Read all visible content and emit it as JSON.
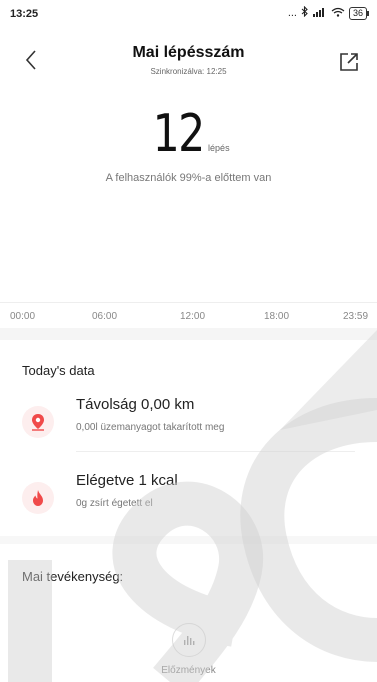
{
  "status_bar": {
    "time": "13:25",
    "dots": "...",
    "battery": "36"
  },
  "header": {
    "title": "Mai lépésszám",
    "subtitle": "Szinkronizálva: 12:25"
  },
  "steps": {
    "value": "12",
    "unit": "lépés",
    "rank_text": "A felhasználók 99%-a előttem van"
  },
  "timeline": {
    "ticks": [
      "00:00",
      "06:00",
      "12:00",
      "18:00",
      "23:59"
    ]
  },
  "today_data": {
    "title": "Today's data",
    "distance": {
      "label": "Távolság 0,00 km",
      "sub": "0,00l üzemanyagot takarított meg"
    },
    "burned": {
      "label": "Elégetve 1 kcal",
      "sub": "0g zsírt égetett el"
    }
  },
  "activity": {
    "title": "Mai tevékenység:"
  },
  "history": {
    "label": "Előzmények"
  },
  "colors": {
    "accent_red": "#f04a4a",
    "icon_bg": "#fdeeee",
    "watermark": "#cfcfcf"
  }
}
